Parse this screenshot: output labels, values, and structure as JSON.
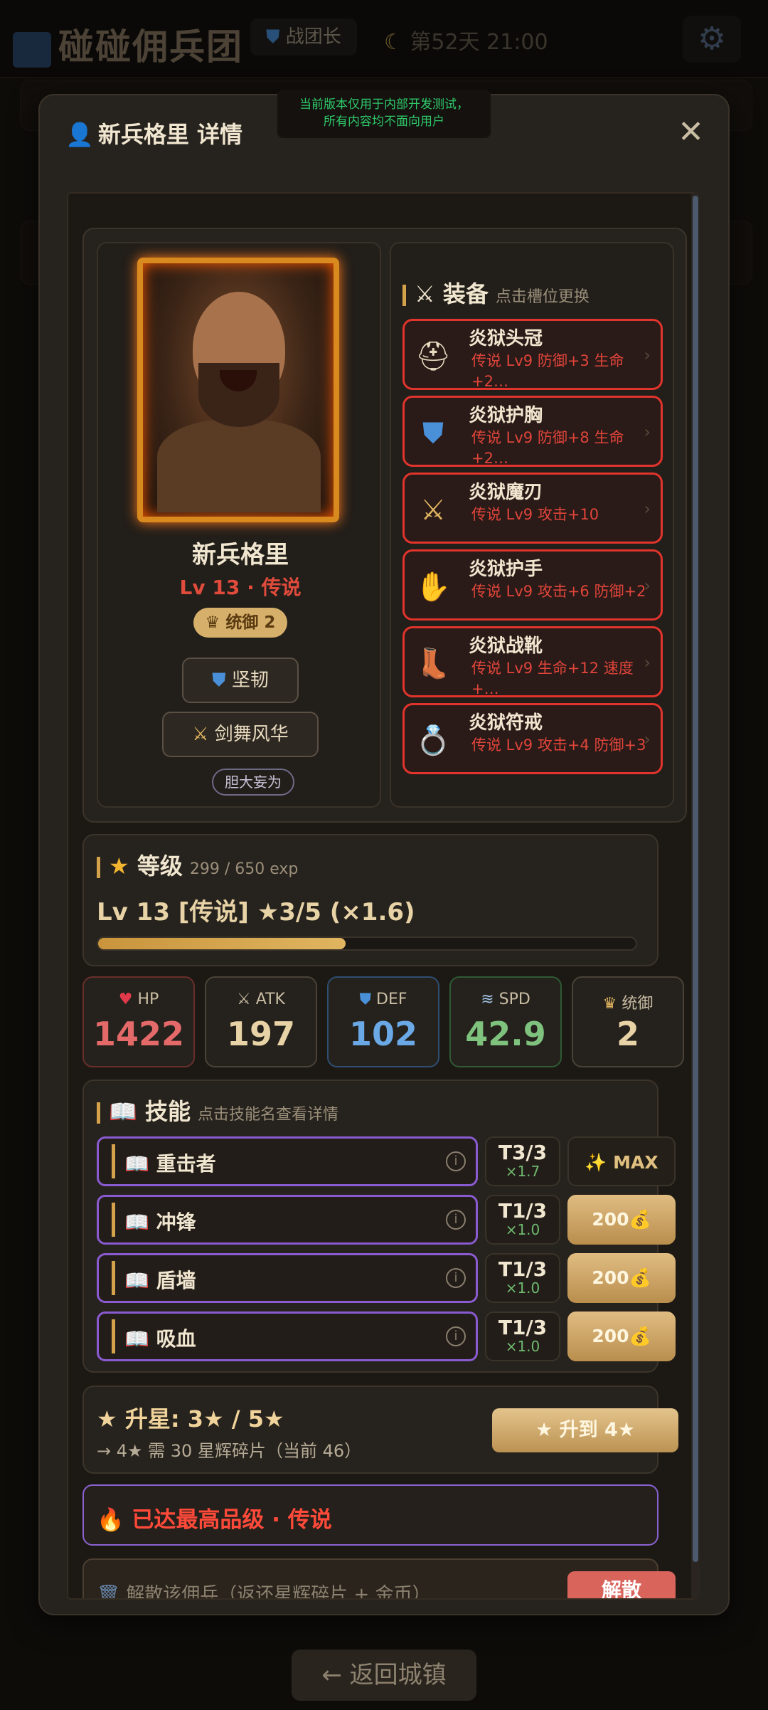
{
  "topbar": {
    "app_title": "碰碰佣兵团",
    "rank_label": "战团长",
    "day_label": "第52天 21:00"
  },
  "footer": {
    "back_label": "← 返回城镇"
  },
  "modal": {
    "title": "新兵格里 详情",
    "dev_notice_line1": "当前版本仅用于内部开发测试，",
    "dev_notice_line2": "所有内容均不面向用户",
    "hero": {
      "name": "新兵格里",
      "level_line": "Lv 13 · 传说",
      "leadership_badge": "统御 2",
      "trait1": "坚韧",
      "trait2": "剑舞风华",
      "personality": "胆大妄为"
    },
    "equipment": {
      "title": "装备",
      "hint": "点击槽位更换",
      "slots": [
        {
          "icon": "helmet",
          "name": "炎狱头冠",
          "stats": "传说 Lv9 防御+3 生命+2…"
        },
        {
          "icon": "shield",
          "name": "炎狱护胸",
          "stats": "传说 Lv9 防御+8 生命+2…"
        },
        {
          "icon": "swords",
          "name": "炎狱魔刃",
          "stats": "传说 Lv9 攻击+10"
        },
        {
          "icon": "gloves",
          "name": "炎狱护手",
          "stats": "传说 Lv9 攻击+6 防御+2"
        },
        {
          "icon": "boots",
          "name": "炎狱战靴",
          "stats": "传说 Lv9 生命+12 速度+…"
        },
        {
          "icon": "ring",
          "name": "炎狱符戒",
          "stats": "传说 Lv9 攻击+4 防御+3"
        }
      ]
    },
    "level": {
      "title": "等级",
      "exp": "299 / 650 exp",
      "line": "Lv 13 [传说] ★3/5 (×1.6)",
      "progress": 0.46
    },
    "stats": [
      {
        "icon": "heart",
        "label": "HP",
        "value": "1422",
        "color": "#e46a6a"
      },
      {
        "icon": "swords",
        "label": "ATK",
        "value": "197",
        "color": "#e8d3a6"
      },
      {
        "icon": "shield",
        "label": "DEF",
        "value": "102",
        "color": "#6aa8e6"
      },
      {
        "icon": "wind",
        "label": "SPD",
        "value": "42.9",
        "color": "#7ec27e"
      },
      {
        "icon": "crown",
        "label": "统御",
        "value": "2",
        "color": "#e8d3a6"
      }
    ],
    "skills": {
      "title": "技能",
      "hint": "点击技能名查看详情",
      "items": [
        {
          "name": "重击者",
          "tier": "T3/3",
          "mult": "×1.7",
          "action": "✨ MAX"
        },
        {
          "name": "冲锋",
          "tier": "T1/3",
          "mult": "×1.0",
          "action": "200💰"
        },
        {
          "name": "盾墙",
          "tier": "T1/3",
          "mult": "×1.0",
          "action": "200💰"
        },
        {
          "name": "吸血",
          "tier": "T1/3",
          "mult": "×1.0",
          "action": "200💰"
        }
      ]
    },
    "star": {
      "title": "★ 升星: 3★ / 5★",
      "detail": "→ 4★ 需 30 星辉碎片（当前 46）",
      "button": "★ 升到 4★"
    },
    "max_quality": "🔥 已达最高品级 · 传说",
    "dismiss": {
      "text": "解散该佣兵（返还星辉碎片 + 金币）",
      "button": "解散"
    }
  }
}
